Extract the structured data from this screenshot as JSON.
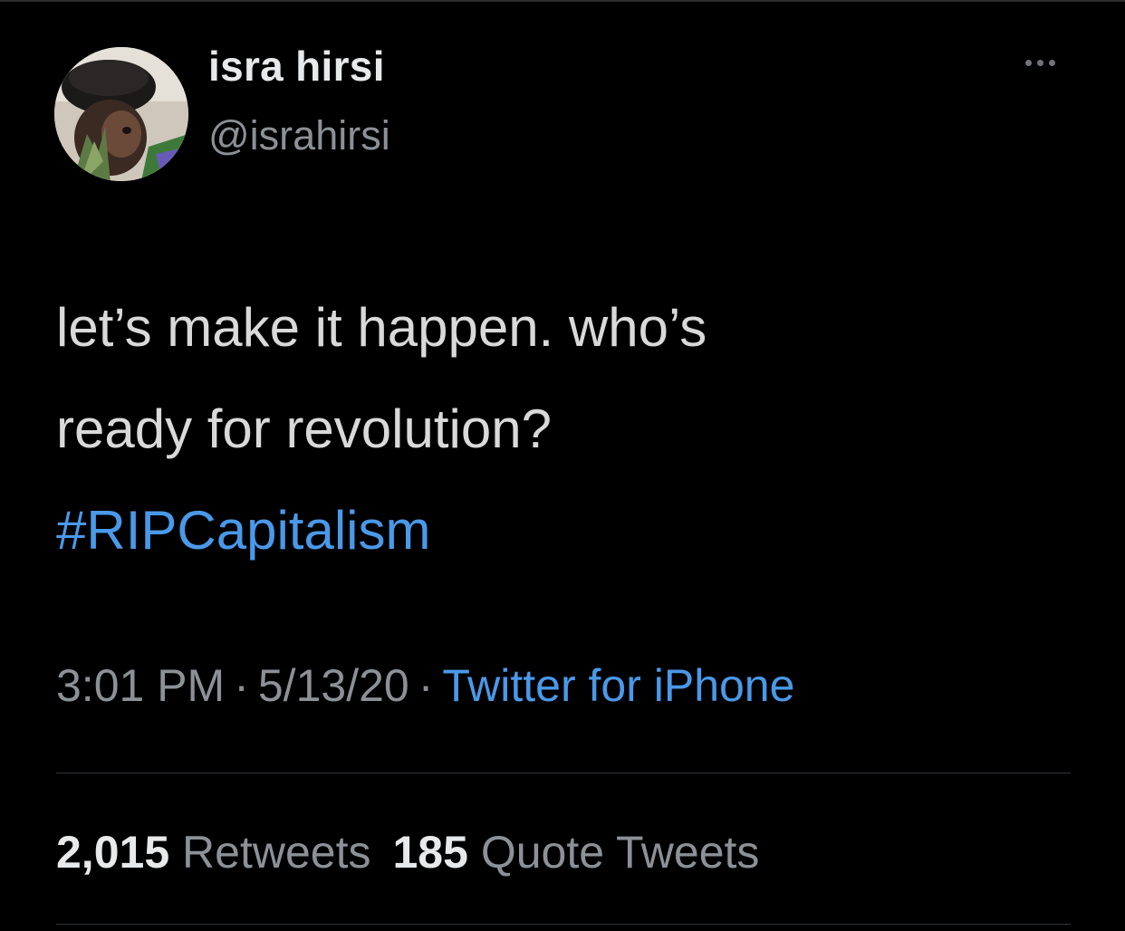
{
  "tweet": {
    "author": {
      "display_name": "isra hirsi",
      "handle": "@israhirsi"
    },
    "text_lines": [
      "let’s make it happen. who’s",
      "ready for revolution?"
    ],
    "hashtag": "#RIPCapitalism",
    "time": "3:01 PM",
    "separator": "·",
    "date": "5/13/20",
    "source": "Twitter for iPhone",
    "stats": {
      "retweets_count": "2,015",
      "retweets_label": "Retweets",
      "quote_tweets_count": "185",
      "quote_tweets_label": "Quote Tweets"
    }
  },
  "colors": {
    "background": "#000000",
    "link": "#4a99e9",
    "secondary_text": "#8b9196",
    "primary_text": "#d9d9d9"
  },
  "icons": {
    "more": "more-horizontal-icon"
  }
}
